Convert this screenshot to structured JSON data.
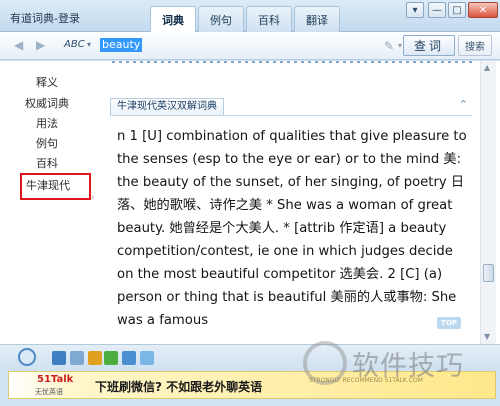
{
  "window": {
    "title": "有道词典-登录",
    "tabs": [
      {
        "label": "词典",
        "active": true
      },
      {
        "label": "例句",
        "active": false
      },
      {
        "label": "百科",
        "active": false
      },
      {
        "label": "翻译",
        "active": false
      }
    ],
    "controls": {
      "menu": "▾",
      "minimize": "—",
      "maximize": "□",
      "close": "✕"
    }
  },
  "toolbar": {
    "back": "◀",
    "forward": "▶",
    "input_mode": "ABC",
    "input_mode_arrow": "▾",
    "search_value": "beauty",
    "pen_icon": "✎",
    "pen_arrow": "▾",
    "lookup_label": "查词",
    "search_label": "搜索"
  },
  "sidebar": {
    "items": [
      {
        "label": "释义"
      },
      {
        "label": "权威词典"
      },
      {
        "label": "用法"
      },
      {
        "label": "例句"
      },
      {
        "label": "百科"
      },
      {
        "label": "牛津现代"
      }
    ],
    "selected_index": 5
  },
  "dictionary": {
    "header": "牛津现代英汉双解词典",
    "collapse": "⌃",
    "content": "n 1 [U] combination of qualities that give pleasure to the senses (esp to the eye or ear) or to the mind 美: the beauty of the sunset, of her singing, of poetry 日落、她的歌喉、诗作之美 * She was a woman of great beauty. 她曾经是个大美人. * [attrib 作定语] a beauty competition/contest, ie one in which judges decide on the most beautiful competitor 选美会. 2 [C] (a) person or thing that is beautiful 美丽的人或事物: She was a famous",
    "top_button": "TOP"
  },
  "scrollbar": {
    "position": 0.72
  },
  "ad": {
    "logo": "51Talk",
    "logo_sub": "无忧英语",
    "text": "下班刷微信? 不如跟老外聊英语",
    "small_text": "STRONGLY RECOMMEND 51TALK.COM"
  },
  "watermark": "软件技巧",
  "colors": {
    "accent": "#3399ff",
    "highlight_box": "#e0141e",
    "titlebar": "#c3daee"
  }
}
